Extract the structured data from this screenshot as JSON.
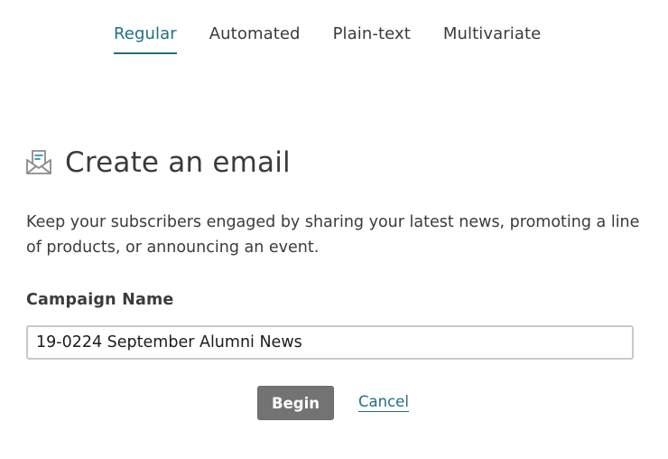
{
  "tabs": [
    {
      "label": "Regular",
      "active": true
    },
    {
      "label": "Automated",
      "active": false
    },
    {
      "label": "Plain-text",
      "active": false
    },
    {
      "label": "Multivariate",
      "active": false
    }
  ],
  "heading": {
    "icon": "email-envelope-icon",
    "title": "Create an email"
  },
  "description": "Keep your subscribers engaged by sharing your latest news, promoting a line of products, or announcing an event.",
  "campaign_name": {
    "label": "Campaign Name",
    "value": "19-0224 September Alumni News"
  },
  "actions": {
    "begin_label": "Begin",
    "cancel_label": "Cancel"
  },
  "colors": {
    "accent": "#1f6f83",
    "text": "#3b3b3b",
    "button_bg": "#737373",
    "input_border": "#c9c9c9"
  }
}
